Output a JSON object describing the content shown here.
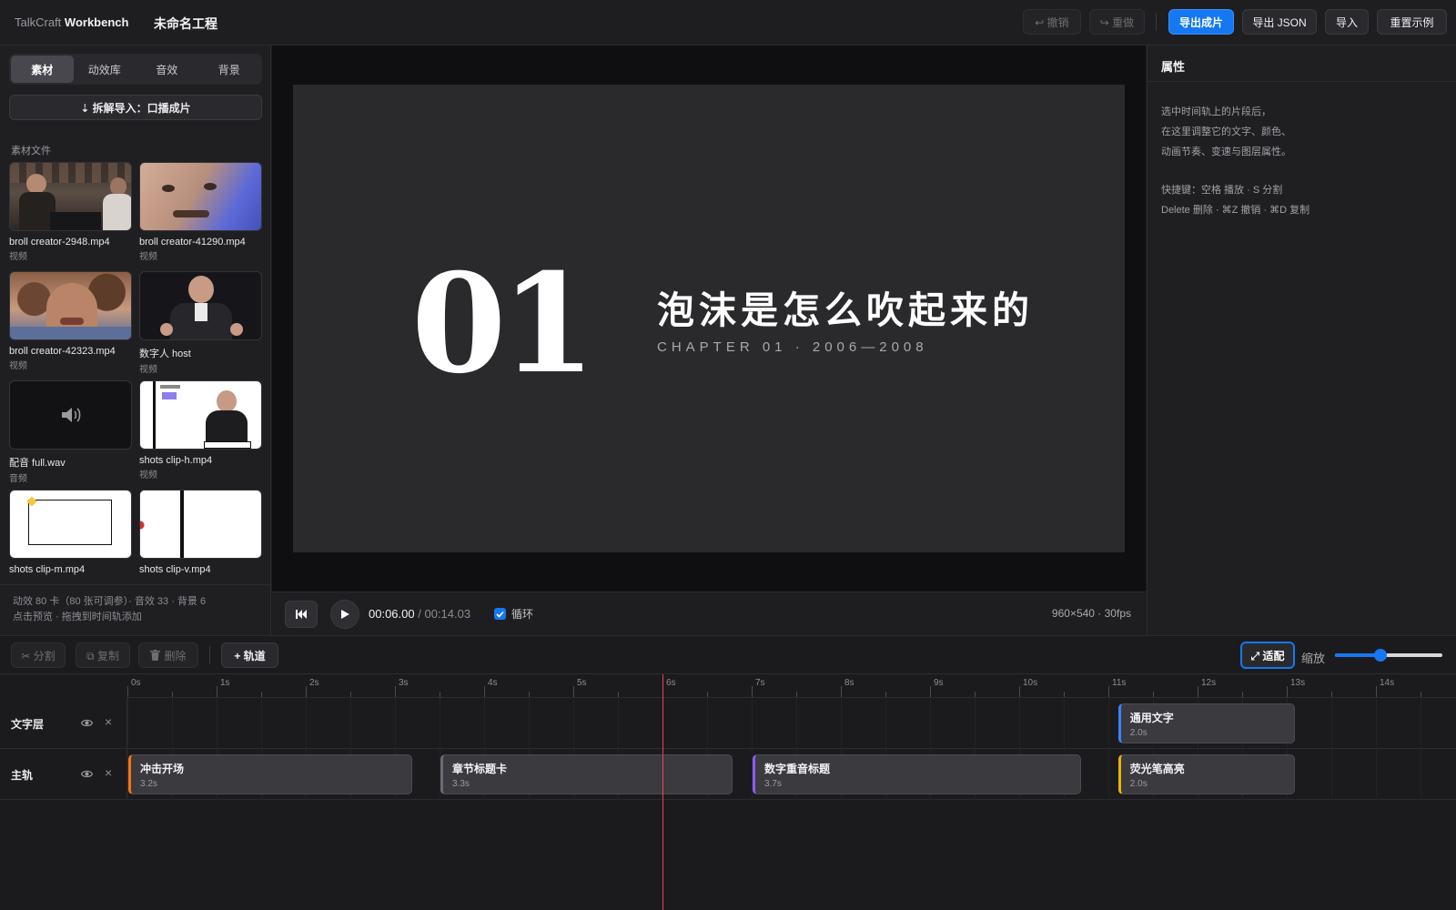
{
  "topbar": {
    "brand_light": "TalkCraft",
    "brand_bold": "Workbench",
    "project_name": "未命名工程",
    "undo_label": "↩ 撤销",
    "redo_label": "↪ 重做",
    "export_video_label": "导出成片",
    "export_json_label": "导出 JSON",
    "import_label": "导入",
    "reset_label": "重置示例"
  },
  "left_panel": {
    "tabs": [
      "素材",
      "动效库",
      "音效",
      "背景"
    ],
    "active_tab": "素材",
    "import_button": "⇣ 拆解导入：口播成片",
    "section_label": "素材文件",
    "assets": [
      {
        "name": "broll creator-2948.mp4",
        "type": "视频"
      },
      {
        "name": "broll creator-41290.mp4",
        "type": "视频"
      },
      {
        "name": "broll creator-42323.mp4",
        "type": "视频"
      },
      {
        "name": "数字人 host",
        "type": "视频"
      },
      {
        "name": "配音 full.wav",
        "type": "音频"
      },
      {
        "name": "shots clip-h.mp4",
        "type": "视频"
      },
      {
        "name": "shots clip-m.mp4",
        "type": "视频"
      },
      {
        "name": "shots clip-v.mp4",
        "type": "视频"
      }
    ],
    "footer_line1": "动效 80 卡（80 张可调参）· 音效 33 · 背景 6",
    "footer_line2": "点击预览 · 拖拽到时间轨添加"
  },
  "preview": {
    "big_number": "01",
    "chapter_title": "泡沫是怎么吹起来的",
    "chapter_subtitle": "CHAPTER 01 · 2006—2008",
    "current_time": "00:06.00",
    "total_time": "/ 00:14.03",
    "loop_label": "循环",
    "loop_checked": true,
    "resolution": "960×540 · 30fps"
  },
  "properties": {
    "title": "属性",
    "hint_line1": "选中时间轨上的片段后，",
    "hint_line2": "在这里调整它的文字、颜色、",
    "hint_line3": "动画节奏、变速与图层属性。",
    "shortcut_line1": "快捷键：空格 播放 · S 分割",
    "shortcut_line2": "Delete 删除 · ⌘Z 撤销 · ⌘D 复制"
  },
  "timeline": {
    "split_label": "✂ 分割",
    "copy_label": "⧉ 复制",
    "delete_label": "删除",
    "add_track_label": "+ 轨道",
    "fit_label": "⤢ 适配",
    "zoom_label": "缩放",
    "zoom_level": 0.42,
    "ruler_labels": [
      "0s",
      "1s",
      "2s",
      "3s",
      "4s",
      "5s",
      "6s",
      "7s",
      "8s",
      "9s",
      "10s",
      "11s",
      "12s",
      "13s",
      "14s"
    ],
    "playhead_seconds": 6.0,
    "tracks": [
      {
        "name": "文字层",
        "clips": [
          {
            "name": "通用文字",
            "duration": "2.0s",
            "start": 11.1,
            "length": 2.0,
            "color": "#3b82f6"
          }
        ]
      },
      {
        "name": "主轨",
        "clips": [
          {
            "name": "冲击开场",
            "duration": "3.2s",
            "start": 0.0,
            "length": 3.2,
            "color": "#f97316"
          },
          {
            "name": "章节标题卡",
            "duration": "3.3s",
            "start": 3.5,
            "length": 3.3,
            "color": "#6b6b72"
          },
          {
            "name": "数字重音标题",
            "duration": "3.7s",
            "start": 7.0,
            "length": 3.7,
            "color": "#8b5cf6"
          },
          {
            "name": "荧光笔高亮",
            "duration": "2.0s",
            "start": 11.1,
            "length": 2.0,
            "color": "#eab308"
          }
        ]
      }
    ]
  },
  "colors": {
    "accent": "#1677f2",
    "playhead": "#e5484d"
  }
}
